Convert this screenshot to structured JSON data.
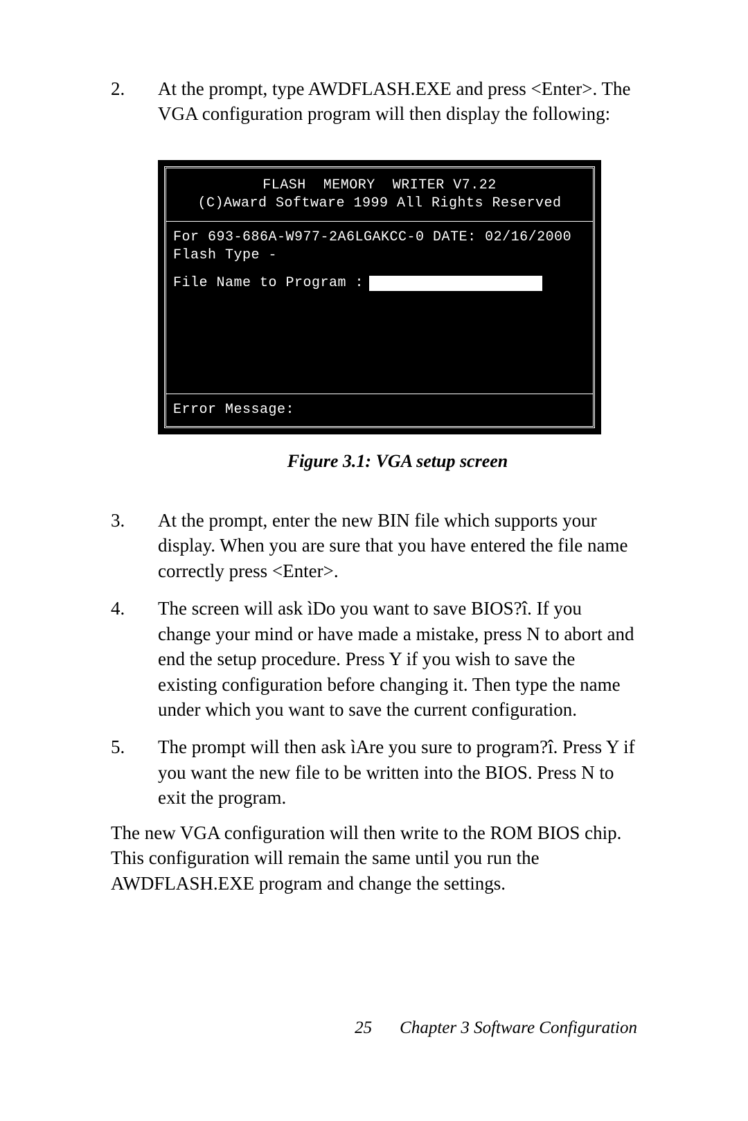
{
  "steps": {
    "s2": {
      "num": "2.",
      "text": "At the prompt, type AWDFLASH.EXE and press <Enter>. The VGA configuration program will then display the following:"
    },
    "s3": {
      "num": "3.",
      "text": "At the prompt, enter the new BIN file which supports your display. When you are sure that you have entered the file name correctly press <Enter>."
    },
    "s4": {
      "num": "4.",
      "text": "The screen will ask ìDo you want to save BIOS?î. If you change your mind or have made a mistake, press N to abort and end the setup procedure. Press Y if you wish to save the existing configuration before changing it. Then type the name under which you want to save the current configuration."
    },
    "s5": {
      "num": "5.",
      "text": "The prompt will then ask ìAre you sure to program?î. Press Y if you want the new file to be written into the BIOS. Press N to exit the program."
    }
  },
  "terminal": {
    "title": "FLASH  MEMORY  WRITER V7.22",
    "copyright": "(C)Award Software 1999 All Rights Reserved",
    "info1": "For 693-686A-W977-2A6LGAKCC-0 DATE: 02/16/2000",
    "info2": "Flash Type -",
    "prompt": "File Name to Program :",
    "error": "Error Message:"
  },
  "figure_caption": "Figure 3.1: VGA setup screen",
  "closing": "The new VGA configuration will then write to the ROM BIOS chip. This configuration will remain the same until you run the AWDFLASH.EXE program and change the settings.",
  "footer": {
    "page": "25",
    "chapter": "Chapter 3  Software Configuration"
  }
}
